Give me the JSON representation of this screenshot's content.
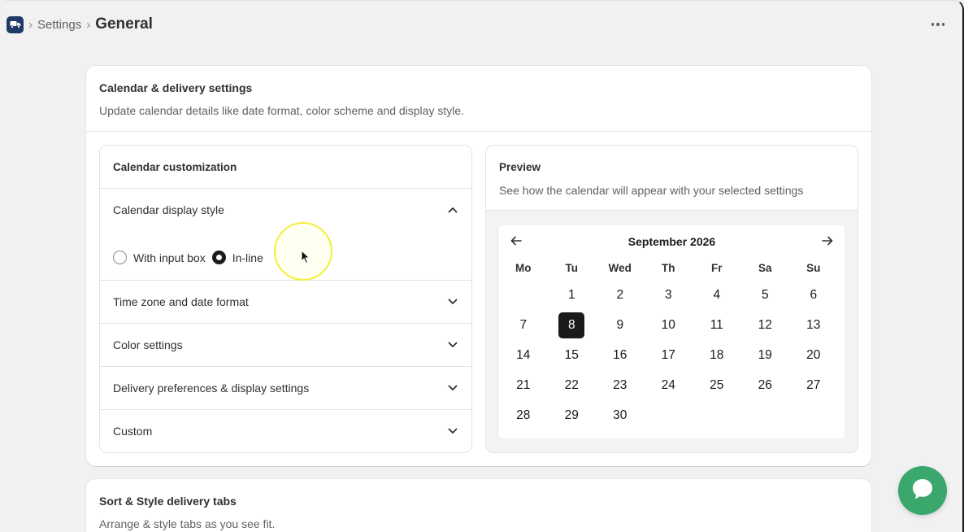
{
  "breadcrumb": {
    "app_icon": "truck-icon",
    "parent": "Settings",
    "current": "General"
  },
  "card_main": {
    "title": "Calendar & delivery settings",
    "subtitle": "Update calendar details like date format, color scheme and display style."
  },
  "customization": {
    "heading": "Calendar customization",
    "display_style": {
      "label": "Calendar display style",
      "options": [
        "With input box",
        "In-line"
      ],
      "selected": "In-line"
    },
    "sections": [
      "Time zone and date format",
      "Color settings",
      "Delivery preferences & display settings",
      "Custom"
    ]
  },
  "preview": {
    "heading": "Preview",
    "subtitle": "See how the calendar will appear with your selected settings",
    "calendar": {
      "month": "September 2026",
      "weekdays": [
        "Mo",
        "Tu",
        "Wed",
        "Th",
        "Fr",
        "Sa",
        "Su"
      ],
      "weeks": [
        [
          "",
          "1",
          "2",
          "3",
          "4",
          "5",
          "6"
        ],
        [
          "7",
          "8",
          "9",
          "10",
          "11",
          "12",
          "13"
        ],
        [
          "14",
          "15",
          "16",
          "17",
          "18",
          "19",
          "20"
        ],
        [
          "21",
          "22",
          "23",
          "24",
          "25",
          "26",
          "27"
        ],
        [
          "28",
          "29",
          "30",
          "",
          "",
          "",
          ""
        ]
      ],
      "selected_day": "8"
    }
  },
  "card_sort": {
    "title": "Sort & Style delivery tabs",
    "subtitle": "Arrange & style tabs as you see fit."
  },
  "colors": {
    "accent": "#1a1a1a",
    "chat": "#3aa76d",
    "app_icon_bg": "#1f3a68"
  }
}
